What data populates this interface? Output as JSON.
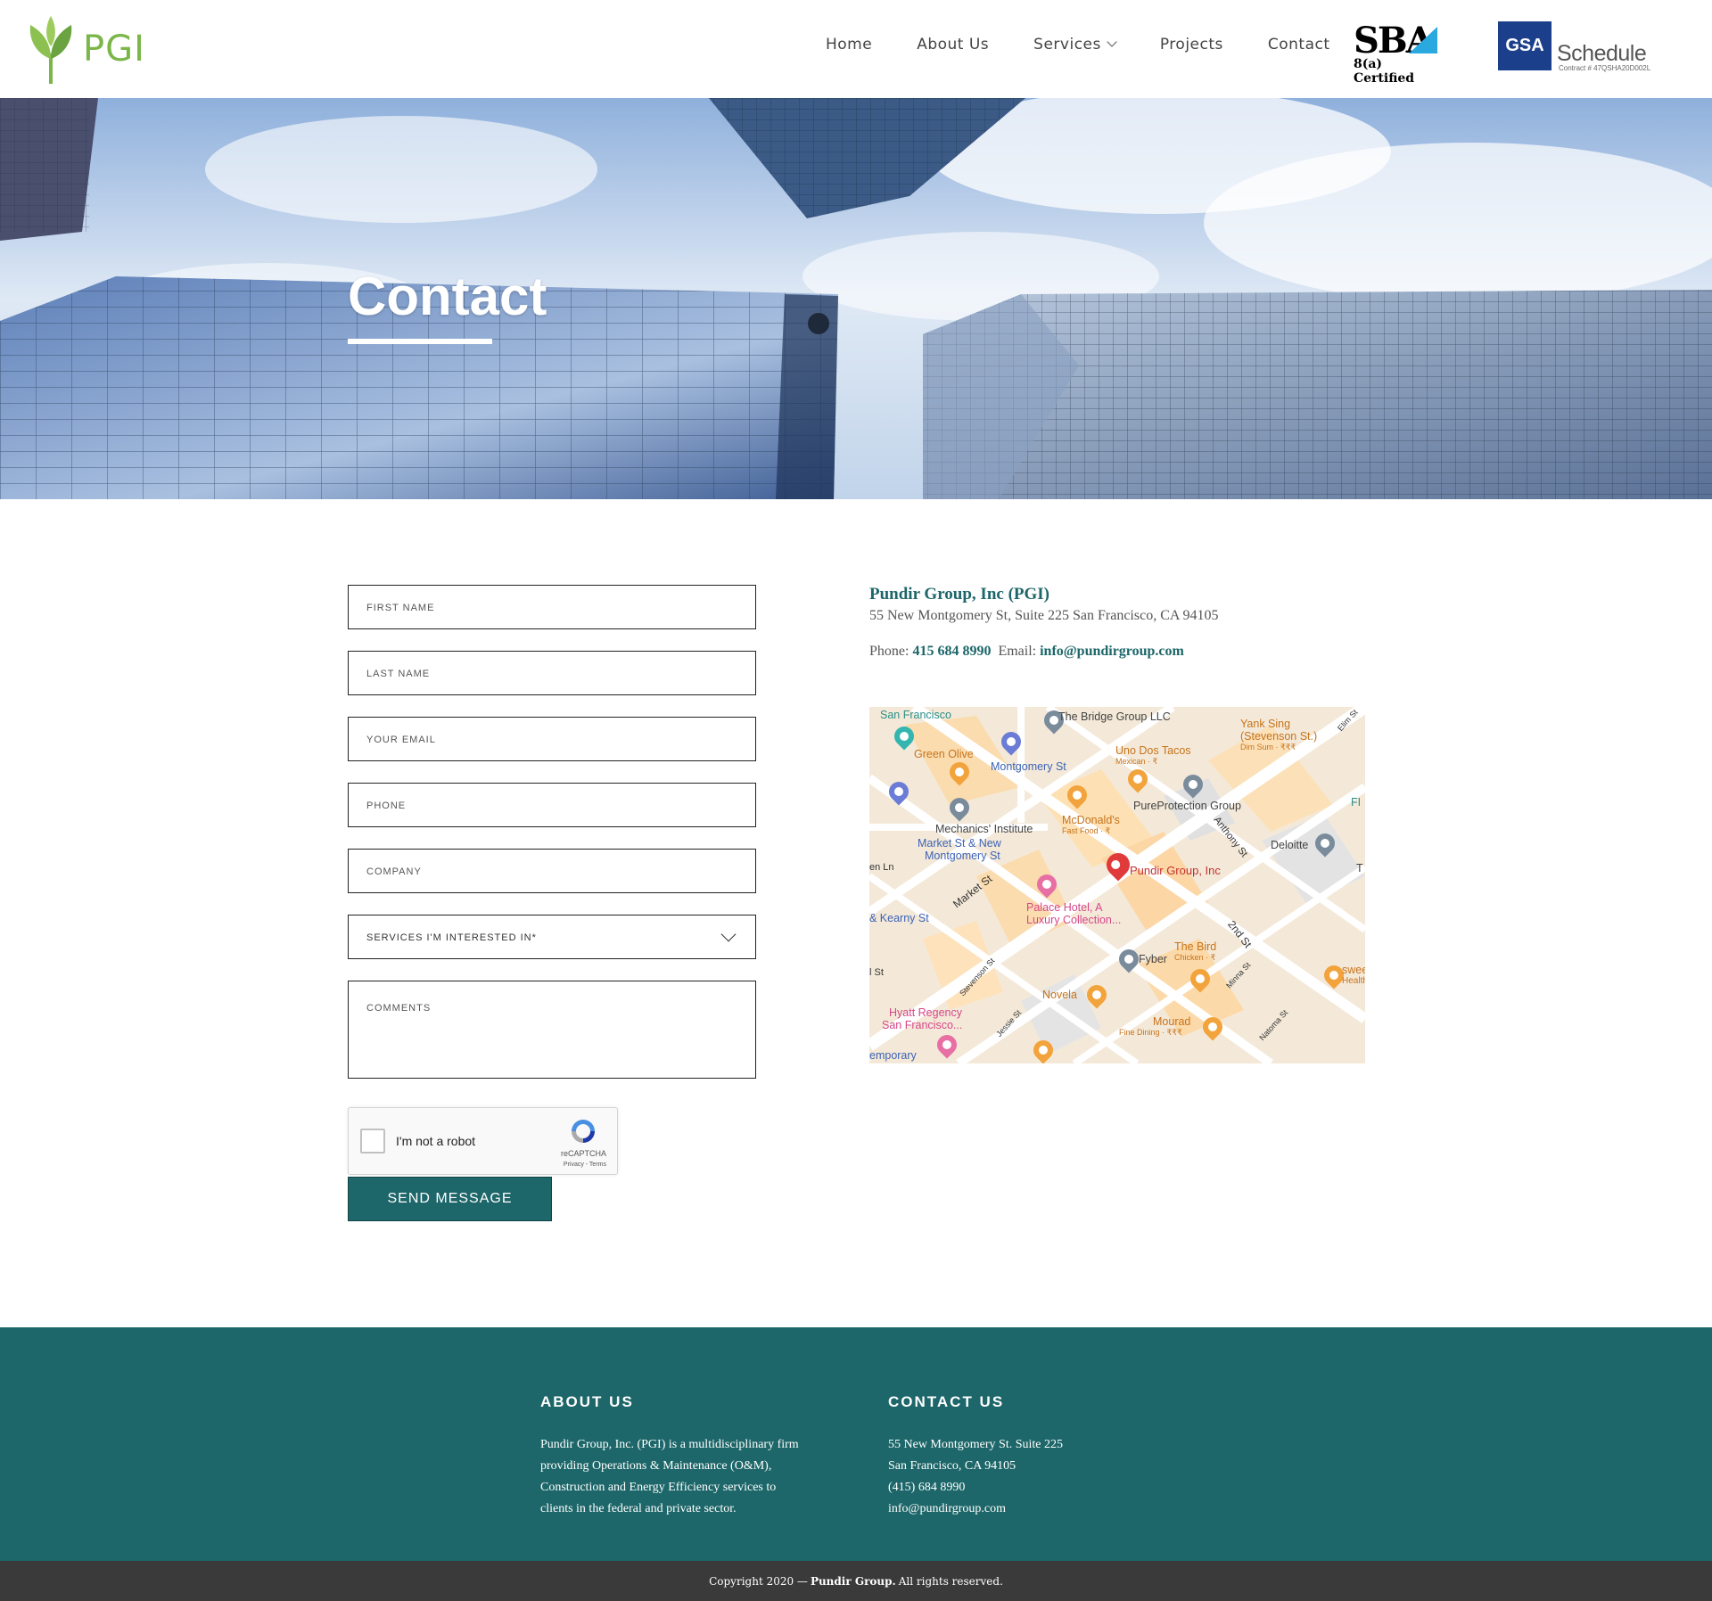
{
  "header": {
    "logo_text": "PGI",
    "nav": [
      {
        "label": "Home"
      },
      {
        "label": "About Us"
      },
      {
        "label": "Services"
      },
      {
        "label": "Projects"
      },
      {
        "label": "Contact"
      }
    ],
    "sba_big": "SBA",
    "sba_sub": "8(a) Certified",
    "gsa_box": "GSA",
    "gsa_word": "Schedule",
    "gsa_contract": "Contract # 47QSHA20D002L"
  },
  "hero": {
    "title": "Contact"
  },
  "form": {
    "first_name_placeholder": "FIRST NAME",
    "last_name_placeholder": "LAST NAME",
    "email_placeholder": "YOUR EMAIL",
    "phone_placeholder": "PHONE",
    "company_placeholder": "COMPANY",
    "services_placeholder": "SERVICES I'M INTERESTED IN*",
    "comments_placeholder": "COMMENTS",
    "recaptcha_label": "I'm not a robot",
    "recaptcha_brand": "reCAPTCHA",
    "recaptcha_terms": "Privacy - Terms",
    "send_label": "SEND MESSAGE"
  },
  "contact_info": {
    "company": "Pundir Group, Inc (PGI)",
    "address": "55 New Montgomery St, Suite 225 San Francisco, CA 94105",
    "phone_label": "Phone:",
    "phone": "415 684 8990",
    "email_label": "Email:",
    "email": "info@pundirgroup.com"
  },
  "map": {
    "labels": {
      "sf_top": "San Francisco",
      "bridge_group": "The Bridge Group LLC",
      "yank_sing": "Yank Sing",
      "yank_sing_sub": "(Stevenson St.)",
      "yank_sing_cat": "Dim Sum · ₹₹₹",
      "green_olive": "Green Olive",
      "uno_dos": "Uno Dos Tacos",
      "uno_dos_cat": "Mexican · ₹",
      "montgomery_st": "Montgomery St",
      "mcdonalds": "McDonald's",
      "mcdonalds_cat": "Fast Food · ₹",
      "pureprotection": "PureProtection Group",
      "mechanics": "Mechanics' Institute",
      "market_new_montgomery": "Market St & New",
      "market_new_montgomery2": "Montgomery St",
      "deloitte": "Deloitte",
      "pundir": "Pundir Group, Inc",
      "palace": "Palace Hotel, A",
      "palace2": "Luxury Collection...",
      "kearny": "& Kearny St",
      "the_bird": "The Bird",
      "the_bird_cat": "Chicken · ₹",
      "fyber": "Fyber",
      "novela": "Novela",
      "hyatt": "Hyatt Regency",
      "hyatt2": "San Francisco...",
      "mourad": "Mourad",
      "mourad_cat": "Fine Dining · ₹₹₹",
      "sweet": "swee",
      "sweet2": "Health",
      "temporary": "emporary",
      "fi": "FI",
      "t": "T",
      "en_ln": "en Ln",
      "st": "l St",
      "market_st": "Market St",
      "anthony_st": "Anthony St",
      "second_st": "2nd St",
      "stevenson_st": "Stevenson St",
      "minna_st": "Minna St",
      "jessie_st": "Jessie St",
      "natoma_st": "Natoma St",
      "elim_st": "Elim St"
    }
  },
  "footer": {
    "about_heading": "ABOUT US",
    "about_lines": [
      "Pundir Group, Inc. (PGI) is a multidisciplinary firm",
      "providing Operations & Maintenance (O&M),",
      "Construction and Energy Efficiency services to",
      "clients in the federal and private sector."
    ],
    "contact_heading": "CONTACT US",
    "contact_lines": [
      "55 New Montgomery St. Suite 225",
      "San Francisco, CA 94105",
      "(415) 684 8990",
      "info@pundirgroup.com"
    ],
    "copyright_pre": "Copyright 2020 —",
    "copyright_name": "Pundir Group.",
    "copyright_post": "All rights reserved."
  },
  "colors": {
    "brand_teal": "#1d6669",
    "logo_green": "#7ab648",
    "copyright_bg": "#3a3a3a"
  }
}
